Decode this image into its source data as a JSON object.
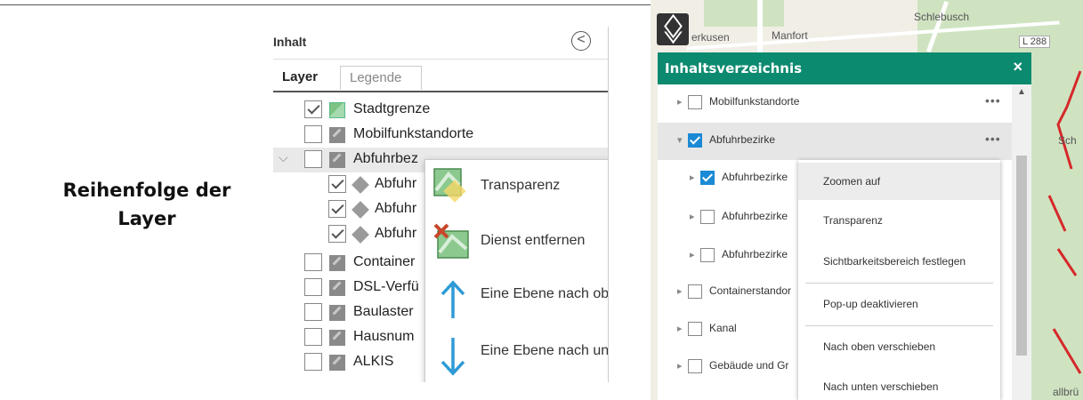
{
  "caption": {
    "line1": "Reihenfolge der",
    "line2": "Layer"
  },
  "old_panel": {
    "title": "Inhalt",
    "collapse_glyph": "<",
    "tabs": [
      "Layer",
      "Legende"
    ],
    "rows": [
      {
        "label": "Stadtgrenze",
        "checked": true,
        "icon": "map-layer-icon"
      },
      {
        "label": "Mobilfunkstandorte",
        "checked": false,
        "icon": "layer-icon"
      },
      {
        "label": "Abfuhrbez",
        "checked": false,
        "icon": "layer-icon",
        "expanded": true
      },
      {
        "label": "Abfuhr",
        "checked": true,
        "icon": "sublayer-icon"
      },
      {
        "label": "Abfuhr",
        "checked": true,
        "icon": "sublayer-icon"
      },
      {
        "label": "Abfuhr",
        "checked": true,
        "icon": "sublayer-icon"
      },
      {
        "label": "Container",
        "checked": false,
        "icon": "layer-icon"
      },
      {
        "label": "DSL-Verfü",
        "checked": false,
        "icon": "layer-icon"
      },
      {
        "label": "Baulaster",
        "checked": false,
        "icon": "layer-icon"
      },
      {
        "label": "Hausnum",
        "checked": false,
        "icon": "layer-icon"
      },
      {
        "label": "ALKIS",
        "checked": false,
        "icon": "layer-icon"
      }
    ],
    "menu": [
      "Transparenz",
      "Dienst entfernen",
      "Eine Ebene nach oben",
      "Eine Ebene nach unten"
    ]
  },
  "new_panel": {
    "map_labels": [
      "Schlebusch",
      "erkusen",
      "Manfort",
      "L 288",
      "Sch",
      "allbrü"
    ],
    "header_title": "Inhaltsverzeichnis",
    "close_glyph": "×",
    "rows": [
      {
        "label": "Mobilfunkstandorte",
        "checked": false,
        "indent": 0
      },
      {
        "label": "Abfuhrbezirke",
        "checked": true,
        "indent": 0,
        "expanded": true
      },
      {
        "label": "Abfuhrbezirke",
        "checked": true,
        "indent": 1
      },
      {
        "label": "Abfuhrbezirke",
        "checked": false,
        "indent": 1
      },
      {
        "label": "Abfuhrbezirke",
        "checked": false,
        "indent": 1
      },
      {
        "label": "Containerstandor",
        "checked": false,
        "indent": 0
      },
      {
        "label": "Kanal",
        "checked": false,
        "indent": 0
      },
      {
        "label": "Gebäude und Gr",
        "checked": false,
        "indent": 0
      }
    ],
    "dots": "•••",
    "menu": [
      "Zoomen auf",
      "Transparenz",
      "Sichtbarkeitsbereich festlegen",
      "Pop-up deaktivieren",
      "Nach oben verschieben",
      "Nach unten verschieben"
    ]
  }
}
